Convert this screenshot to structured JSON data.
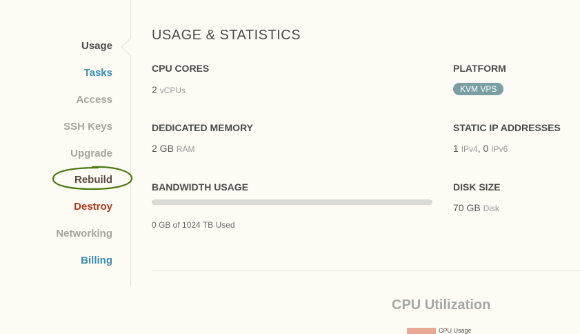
{
  "sidebar": {
    "items": [
      {
        "label": "Usage"
      },
      {
        "label": "Tasks"
      },
      {
        "label": "Access"
      },
      {
        "label": "SSH Keys"
      },
      {
        "label": "Upgrade"
      },
      {
        "label": "Rebuild"
      },
      {
        "label": "Destroy"
      },
      {
        "label": "Networking"
      },
      {
        "label": "Billing"
      }
    ]
  },
  "main": {
    "title": "USAGE & STATISTICS",
    "cpu": {
      "label": "CPU CORES",
      "value": "2",
      "unit": "vCPUs"
    },
    "platform": {
      "label": "PLATFORM",
      "badge": "KVM VPS"
    },
    "memory": {
      "label": "DEDICATED MEMORY",
      "value": "2 GB",
      "unit": "RAM"
    },
    "static_ip": {
      "label": "STATIC IP ADDRESSES",
      "ipv4_value": "1",
      "ipv4_unit": "IPv4",
      "separator": ",",
      "ipv6_value": "0",
      "ipv6_unit": "IPv6"
    },
    "bandwidth": {
      "label": "BANDWIDTH USAGE",
      "used_text": "0 GB of 1024 TB Used",
      "used_fraction": 0
    },
    "disk": {
      "label": "DISK SIZE",
      "value": "70 GB",
      "unit": "Disk"
    }
  },
  "cpu_chart": {
    "title": "CPU Utilization",
    "legend": "CPU Usage",
    "legend_color": "#e7a995"
  },
  "colors": {
    "link": "#3a8fb7",
    "danger": "#b0391f",
    "annotation": "#4a7a12",
    "badge": "#7a9ea4"
  }
}
